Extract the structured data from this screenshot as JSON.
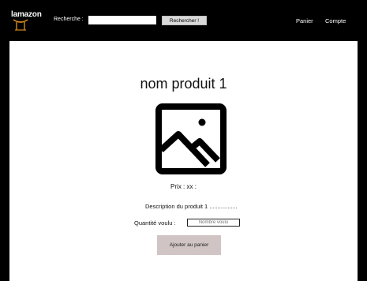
{
  "header": {
    "logo_text": "lamazon",
    "search_label": "Recherche :",
    "search_value": "",
    "search_button_label": "Rechercher !",
    "cart_label": "Panier",
    "account_label": "Compte"
  },
  "product": {
    "name": "nom produit 1",
    "image_icon": "image-placeholder-icon",
    "price_text": "Prix : xx :",
    "description_text": "Description du produit 1 .................",
    "quantity_label": "Quantité voulu :",
    "quantity_placeholder": "Nombre voulu",
    "add_to_cart_label": "Ajouter au panier"
  },
  "colors": {
    "header_background": "#000000",
    "add_button_background": "#d0c4c4",
    "search_button_background": "#d9d9d9"
  }
}
